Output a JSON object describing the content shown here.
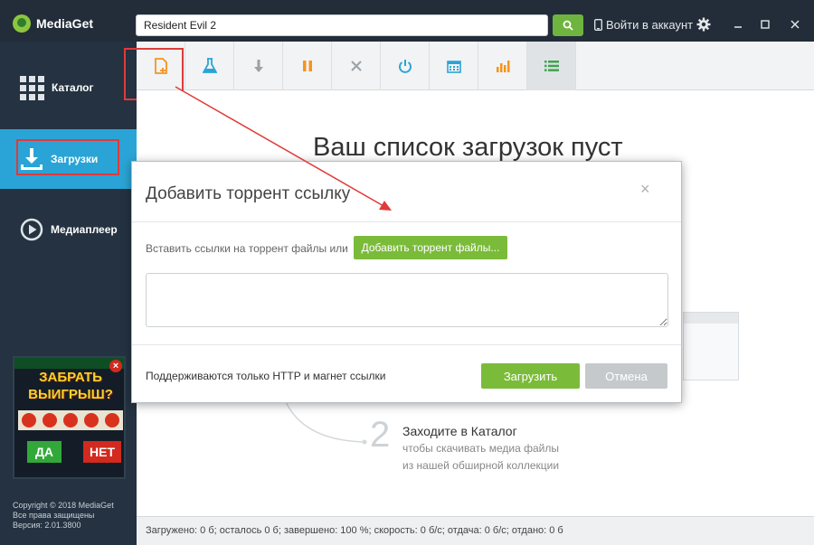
{
  "app": {
    "name": "MediaGet"
  },
  "search": {
    "value": "Resident Evil 2"
  },
  "header": {
    "login_label": "Войти в аккаунт"
  },
  "sidebar": {
    "items": [
      {
        "label": "Каталог"
      },
      {
        "label": "Загрузки"
      },
      {
        "label": "Медиаплеер"
      }
    ],
    "ad": {
      "headline_line1": "ЗАБРАТЬ",
      "headline_line2": "ВЫИГРЫШ?",
      "yes_label": "ДА",
      "no_label": "НЕТ"
    },
    "copyright": {
      "line1": "Copyright © 2018 MediaGet",
      "line2": "Все права защищены",
      "line3": "Версия: 2.01.3800"
    }
  },
  "toolbar": {
    "icons": [
      "add-torrent-icon",
      "flask-icon",
      "download-arrow-icon",
      "pause-icon",
      "delete-x-icon",
      "power-icon",
      "calendar-icon",
      "bar-chart-icon",
      "list-icon"
    ]
  },
  "main": {
    "empty_title": "Ваш список загрузок пуст",
    "step2": {
      "number": "2",
      "title": "Заходите в Каталог",
      "desc_line1": "чтобы скачивать медиа файлы",
      "desc_line2": "из нашей обширной коллекции"
    }
  },
  "dialog": {
    "title": "Добавить торрент ссылку",
    "close_label": "×",
    "prompt": "Вставить ссылки на торрент файлы или",
    "add_files_label": "Добавить торрент файлы...",
    "link_value": "",
    "footnote": "Поддерживаются только HTTP и магнет ссылки",
    "upload_label": "Загрузить",
    "cancel_label": "Отмена"
  },
  "statusbar": {
    "text": "Загружено: 0 б; осталось 0 б; завершено: 100 %; скорость: 0 б/с; отдача: 0 б/с; отдано: 0 б"
  },
  "colors": {
    "accent_green": "#7bbb3a",
    "sidebar_active": "#2aa4d6",
    "annotation_red": "#e03a3a",
    "icon_orange": "#f5941e",
    "icon_blue": "#2aa4d6"
  }
}
